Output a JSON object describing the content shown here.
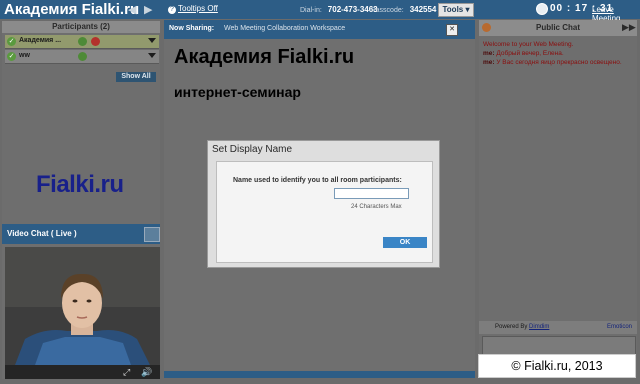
{
  "topbar": {
    "title": "Академия Fialki.ru",
    "tooltips": "Tooltips Off",
    "dialin_label": "Dial-in:",
    "dialin_number": "702-473-3463",
    "passcode_label": "Passcode:",
    "passcode_value": "342554",
    "tools_label": "Tools ▾",
    "timer": "00 : 17 : 31",
    "leave_label": "Leave Meeting"
  },
  "participants": {
    "header": "Participants (2)",
    "items": [
      {
        "name": "Академия ..."
      },
      {
        "name": "ww"
      }
    ],
    "show_all": "Show All"
  },
  "logo_text": "Fialki.ru",
  "video_chat": {
    "header": "Video Chat ( Live )"
  },
  "sharing": {
    "label": "Now Sharing:",
    "document": "Web Meeting Collaboration Workspace",
    "slide_title": "Академия Fialki.ru",
    "slide_subtitle": "интернет-семинар"
  },
  "dialog": {
    "title": "Set Display Name",
    "label": "Name used to identify you to all room participants:",
    "input_value": "",
    "hint": "24 Characters Max",
    "ok_label": "OK"
  },
  "chat": {
    "header": "Public Chat",
    "welcome": "Welcome to your Web Meeting.",
    "messages": [
      {
        "who": "me:",
        "text": "Добрый вечер, Елена."
      },
      {
        "who": "me:",
        "text": "У Вас сегодня яицо прекрасно освещено."
      }
    ],
    "powered_by": "Powered By",
    "powered_link": "Dimdim",
    "emoticon": "Emoticon"
  },
  "copyright": "© Fialki.ru, 2013",
  "colors": {
    "header_blue": "#2d5d86",
    "ok_blue": "#3a85c6",
    "chat_red": "#8a0e0e",
    "logo_blue": "#18208a"
  }
}
